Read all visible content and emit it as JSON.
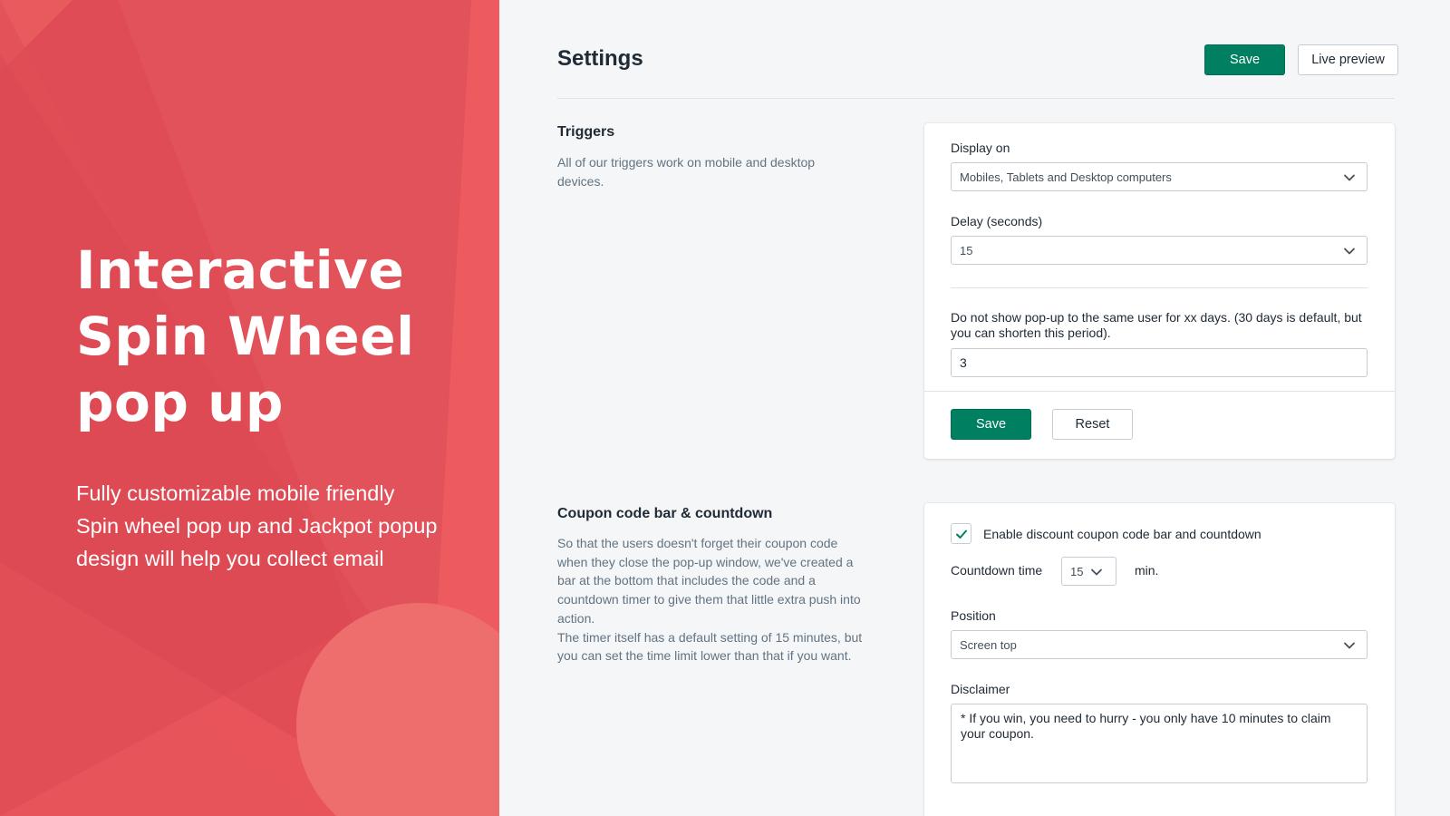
{
  "promo": {
    "title_lines": [
      "Interactive",
      "Spin Wheel",
      "pop up"
    ],
    "subtitle_lines": [
      "Fully customizable mobile friendly",
      "Spin wheel pop up and Jackpot popup",
      "design will help you collect email"
    ]
  },
  "header": {
    "title": "Settings",
    "save_label": "Save",
    "preview_label": "Live preview"
  },
  "triggers": {
    "title": "Triggers",
    "description": "All of our triggers work on mobile and desktop devices.",
    "display_on_label": "Display on",
    "display_on_value": "Mobiles, Tablets and Desktop computers",
    "delay_label": "Delay (seconds)",
    "delay_value": "15",
    "days_label": "Do not show pop-up to the same user for xx days. (30 days is default, but you can shorten this period).",
    "days_value": "3",
    "save_label": "Save",
    "reset_label": "Reset"
  },
  "coupon": {
    "title": "Coupon code bar & countdown",
    "description_1": "So that the users doesn't forget their coupon code when they close the pop-up window, we've created a bar at the bottom that includes the code and a countdown timer to give them that little extra push into action.",
    "description_2": "The timer itself has a default setting of 15 minutes, but you can set the time limit lower than that if you want.",
    "enable_label": "Enable discount coupon code bar and countdown",
    "enable_checked": true,
    "countdown_label": "Countdown time",
    "countdown_value": "15",
    "countdown_unit": "min.",
    "position_label": "Position",
    "position_value": "Screen top",
    "disclaimer_label": "Disclaimer",
    "disclaimer_value": "* If you win, you need to hurry - you only have 10 minutes to claim your coupon."
  },
  "colors": {
    "promo_bg": "#e2525a",
    "primary": "#008060",
    "page_bg": "#f4f6f8"
  },
  "icons": {
    "select_chevron": "chevron-down-icon",
    "checkmark": "checkmark-icon"
  }
}
